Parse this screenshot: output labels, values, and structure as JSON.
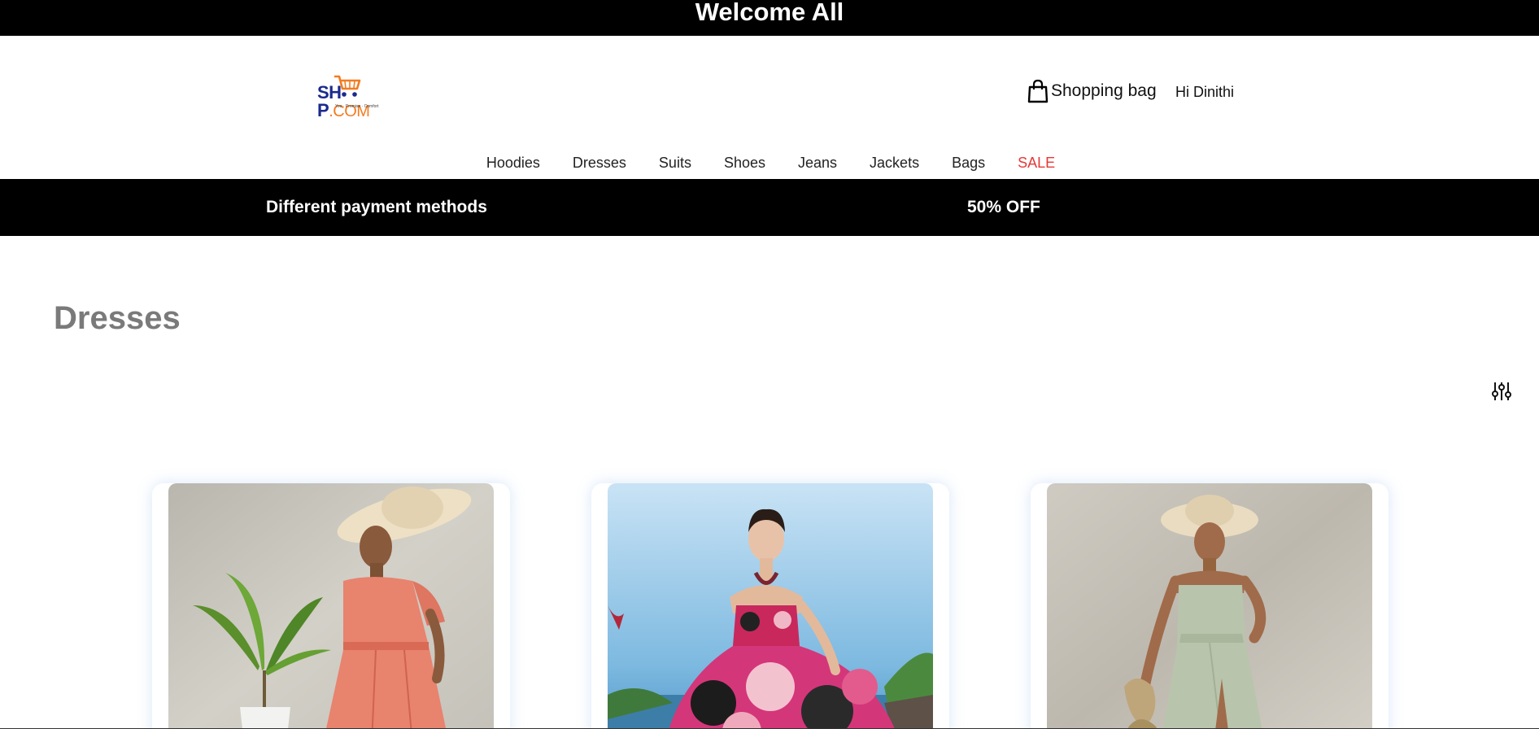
{
  "header": {
    "welcome": "Welcome All",
    "logo": {
      "main_part1": "SH",
      "main_part2": "P",
      "main_suffix": ".COM",
      "tagline": "You · Promise · Comfort"
    },
    "bag_label": "Shopping bag",
    "bag_icon": "shopping-bag-icon",
    "greeting": "Hi Dinithi"
  },
  "nav": {
    "items": [
      "Hoodies",
      "Dresses",
      "Suits",
      "Shoes",
      "Jeans",
      "Jackets",
      "Bags",
      "SALE"
    ],
    "sale_color": "#e53935"
  },
  "promo": {
    "left": "Different payment methods",
    "right": "50% OFF"
  },
  "main": {
    "title": "Dresses",
    "filter_icon": "sliders-icon",
    "products": [
      {
        "image": "woman in coral dress and straw hat beside plant"
      },
      {
        "image": "woman in pink floral strapless gown"
      },
      {
        "image": "woman in sage green wrap dress and straw hat"
      }
    ]
  },
  "colors": {
    "bar_bg": "#000000",
    "title_gray": "#7a7a7a",
    "logo_navy": "#1b2a8c",
    "logo_orange": "#f47c20"
  }
}
